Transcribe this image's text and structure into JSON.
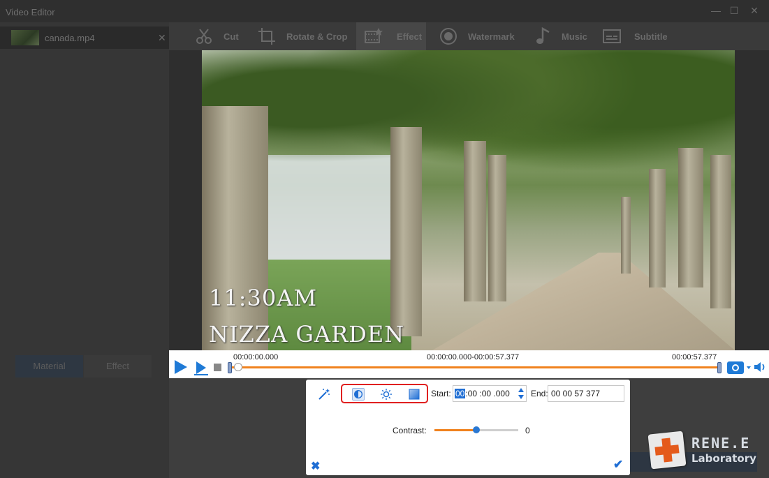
{
  "window": {
    "title": "Video Editor"
  },
  "file": {
    "name": "canada.mp4"
  },
  "left_tabs": {
    "material": "Material",
    "effect": "Effect"
  },
  "toolbar": {
    "cut": "Cut",
    "rotate_crop": "Rotate & Crop",
    "effect": "Effect",
    "watermark": "Watermark",
    "music": "Music",
    "subtitle": "Subtitle"
  },
  "video_overlay": {
    "line1": "11:30AM",
    "line2": "NIZZA GARDEN"
  },
  "timeline": {
    "current": "00:00:00.000",
    "range": "00:00:00.000-00:00:57.377",
    "end": "00:00:57.377"
  },
  "effect_panel": {
    "start_label": "Start:",
    "start_hh": "00",
    "start_rest": ":00 :00 .000",
    "end_label": "End:",
    "end_value": "00  00  57  377",
    "contrast_label": "Contrast:",
    "contrast_value": "0",
    "contrast_level_percent": 50
  },
  "watermark_logo": {
    "line1": "RENE.E",
    "line2": "Laboratory"
  },
  "colors": {
    "accent_blue": "#1f6ed4",
    "accent_orange": "#f0821e",
    "highlight_red": "#e02020"
  }
}
